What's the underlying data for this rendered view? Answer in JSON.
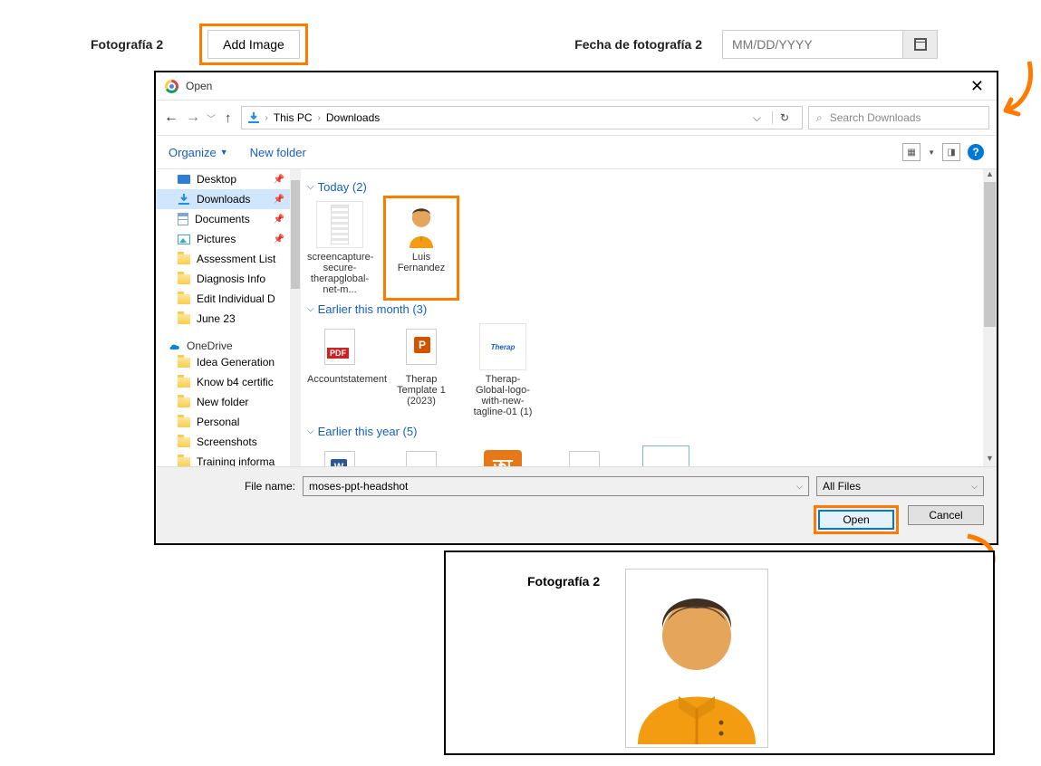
{
  "form": {
    "photo_label": "Fotografía 2",
    "add_image": "Add Image",
    "date_label": "Fecha de fotografía 2",
    "date_placeholder": "MM/DD/YYYY"
  },
  "dialog": {
    "title": "Open",
    "path": {
      "root": "This PC",
      "folder": "Downloads"
    },
    "search_placeholder": "Search Downloads",
    "organize": "Organize",
    "new_folder": "New folder",
    "sidebar": {
      "quick": [
        {
          "label": "Desktop",
          "icon": "desktop",
          "pinned": true
        },
        {
          "label": "Downloads",
          "icon": "download",
          "pinned": true,
          "selected": true
        },
        {
          "label": "Documents",
          "icon": "document",
          "pinned": true
        },
        {
          "label": "Pictures",
          "icon": "picture",
          "pinned": true
        },
        {
          "label": "Assessment List",
          "icon": "folder"
        },
        {
          "label": "Diagnosis Info",
          "icon": "folder"
        },
        {
          "label": "Edit Individual D",
          "icon": "folder"
        },
        {
          "label": "June 23",
          "icon": "folder"
        }
      ],
      "onedrive_label": "OneDrive",
      "onedrive": [
        {
          "label": "Idea Generation"
        },
        {
          "label": "Know b4 certific"
        },
        {
          "label": "New folder"
        },
        {
          "label": "Personal"
        },
        {
          "label": "Screenshots"
        },
        {
          "label": "Training informa"
        }
      ]
    },
    "groups": [
      {
        "title": "Today (2)",
        "items": [
          {
            "name": "screencapture-secure-therapglobal-net-m...",
            "type": "text"
          },
          {
            "name": "Luis Fernandez",
            "type": "avatar",
            "highlight": true
          }
        ]
      },
      {
        "title": "Earlier this month (3)",
        "items": [
          {
            "name": "Accountstatement",
            "type": "pdf"
          },
          {
            "name": "Therap Template 1 (2023)",
            "type": "ppt"
          },
          {
            "name": "Therap-Global-logo-with-new-tagline-01 (1)",
            "type": "therap"
          }
        ]
      },
      {
        "title": "Earlier this year (5)",
        "items": [
          {
            "name": "",
            "type": "word"
          },
          {
            "name": "",
            "type": "pdf"
          },
          {
            "name": "",
            "type": "img"
          },
          {
            "name": "",
            "type": "pdf"
          },
          {
            "name": "",
            "type": "blank"
          }
        ]
      }
    ],
    "filename_label": "File name:",
    "filename_value": "moses-ppt-headshot",
    "filter": "All Files",
    "open": "Open",
    "cancel": "Cancel"
  },
  "preview": {
    "label": "Fotografía 2"
  }
}
